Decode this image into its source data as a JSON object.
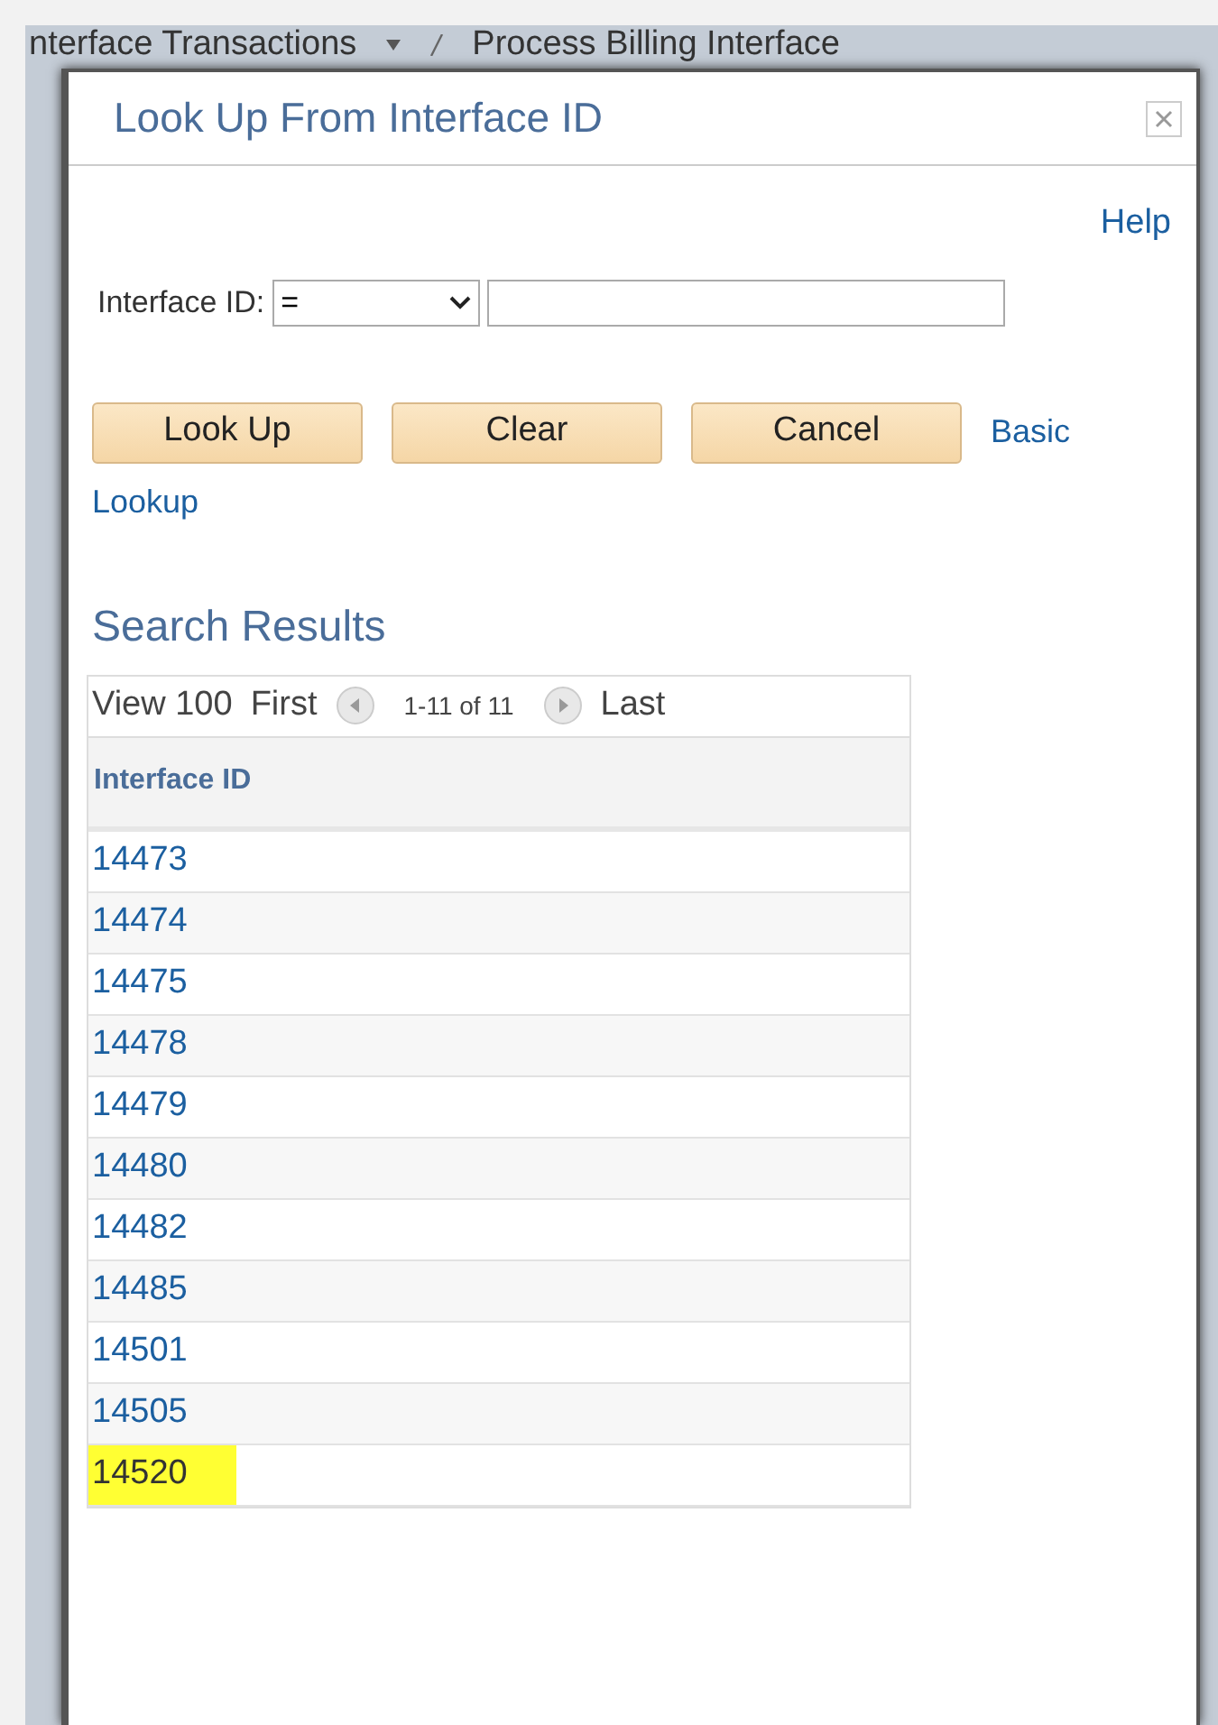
{
  "breadcrumb": [
    {
      "label": "nterface Transactions",
      "kind": "menu"
    },
    {
      "label": "Process Billing Interface",
      "kind": "page"
    }
  ],
  "dialog": {
    "title": "Look Up From Interface ID",
    "help": "Help",
    "criteria": {
      "label": "Interface ID:",
      "operator": "="
    },
    "buttons": [
      "Look Up",
      "Clear",
      "Cancel"
    ],
    "link": "Basic Lookup",
    "results_title": "Search Results",
    "pager": {
      "view": "View 100",
      "first": "First",
      "range": "1-11 of 11",
      "last": "Last"
    },
    "column": "Interface ID",
    "rows": [
      {
        "id": "14473",
        "highlighted": false
      },
      {
        "id": "14474",
        "highlighted": false
      },
      {
        "id": "14475",
        "highlighted": false
      },
      {
        "id": "14478",
        "highlighted": false
      },
      {
        "id": "14479",
        "highlighted": false
      },
      {
        "id": "14480",
        "highlighted": false
      },
      {
        "id": "14482",
        "highlighted": false
      },
      {
        "id": "14485",
        "highlighted": false
      },
      {
        "id": "14501",
        "highlighted": false
      },
      {
        "id": "14505",
        "highlighted": false
      },
      {
        "id": "14520",
        "highlighted": true
      }
    ]
  }
}
